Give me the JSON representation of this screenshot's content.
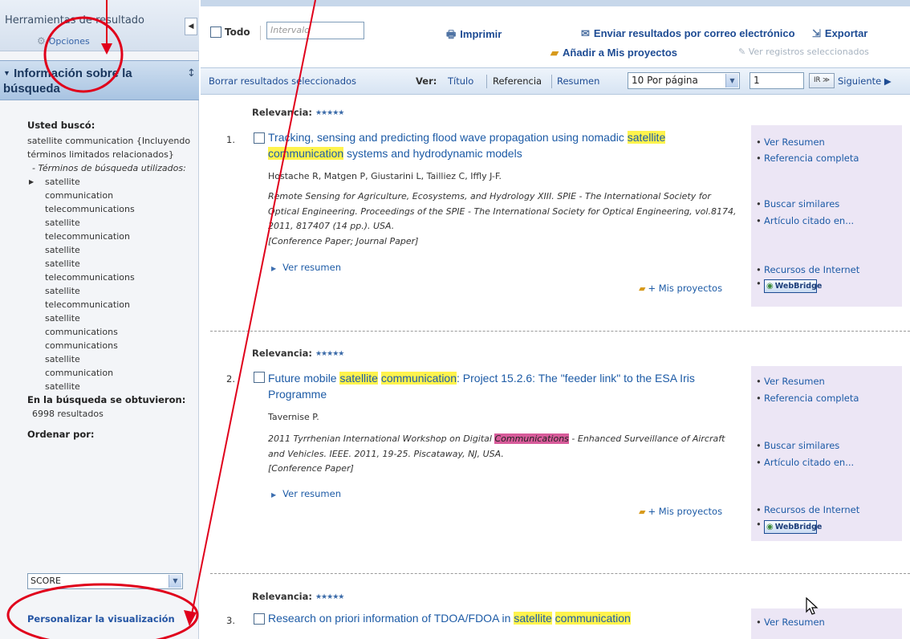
{
  "sidebar": {
    "tools_title": "Herramientas de resultado",
    "options_label": "Opciones",
    "info_title": "Información sobre la búsqueda",
    "searched_label": "Usted buscó:",
    "query": "satellite communication {Incluyendo términos limitados relacionados}",
    "terms_used_label": "- Términos de búsqueda utilizados:",
    "terms": [
      "satellite",
      "communication",
      "telecommunications",
      "satellite",
      "telecommunication",
      "satellite",
      "satellite",
      "telecommunications",
      "satellite",
      "telecommunication",
      "satellite",
      "communications",
      "communications",
      "satellite",
      "communication",
      "satellite"
    ],
    "obtained_label": "En la búsqueda se obtuvieron:",
    "results_count": "6998 resultados",
    "sort_label": "Ordenar por:",
    "sort_value": "SCORE",
    "personalize_label": "Personalizar la visualización"
  },
  "toolbar": {
    "all_label": "Todo",
    "range_placeholder": "Intervalo",
    "print_label": "Imprimir",
    "email_label": "Enviar resultados por correo electrónico",
    "export_label": "Exportar",
    "add_projects_label": "Añadir a Mis proyectos",
    "view_selected_label": "Ver registros seleccionados"
  },
  "nav": {
    "clear_selected": "Borrar resultados seleccionados",
    "view_label": "Ver:",
    "view_title": "Título",
    "view_reference": "Referencia",
    "view_summary": "Resumen",
    "per_page": "10 Por página",
    "page_value": "1",
    "go_label": "IR ≫",
    "next_label": "Siguiente ▶"
  },
  "results": [
    {
      "relevance_label": "Relevancia:",
      "stars": "★★★★★",
      "number": "1.",
      "title_lead": "Tracking, sensing and predicting flood wave propagation using nomadic ",
      "title_hl1": "satellite",
      "title_hl2": "communication",
      "title_tail": " systems and hydrodynamic models",
      "authors": "Hostache R, Matgen P, Giustarini L, Tailliez C, Iffly J-F.",
      "source": "Remote Sensing for Agriculture, Ecosystems, and Hydrology XIII. SPIE - The International Society for Optical Engineering. Proceedings of the SPIE - The International Society for Optical Engineering, vol.8174, 2011, 817407 (14 pp.). USA.",
      "doc_type": "[Conference Paper; Journal Paper]"
    },
    {
      "relevance_label": "Relevancia:",
      "stars": "★★★★★",
      "number": "2.",
      "title_lead": "Future mobile ",
      "title_hl1": "satellite",
      "title_hl2": "communication",
      "title_tail": ": Project 15.2.6: The \"feeder link\" to the ESA Iris Programme",
      "authors": "Tavernise P.",
      "source_lead": "2011 Tyrrhenian International Workshop on Digital ",
      "source_hl": "Communications",
      "source_tail": " - Enhanced Surveillance of Aircraft and Vehicles. IEEE. 2011, 19-25. Piscataway, NJ, USA.",
      "doc_type": "[Conference Paper]"
    },
    {
      "relevance_label": "Relevancia:",
      "stars": "★★★★★",
      "number": "3.",
      "title_lead": "Research on priori information of TDOA/FDOA in ",
      "title_hl1": "satellite",
      "title_hl2": "communication"
    }
  ],
  "result_actions": {
    "view_summary": "Ver resumen",
    "my_projects": "+ Mis proyectos",
    "ver_resumen_side": "Ver Resumen",
    "full_reference": "Referencia completa",
    "find_similar": "Buscar similares",
    "cited_in": "Artículo citado en...",
    "internet_resources": "Recursos de Internet",
    "webbridge": "WebBridge"
  },
  "annotation_color": "#e0001b"
}
